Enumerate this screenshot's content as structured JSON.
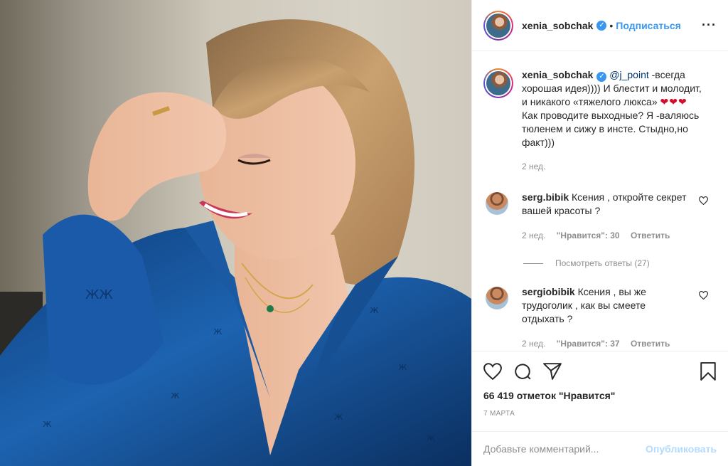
{
  "post": {
    "username": "xenia_sobchak",
    "separator": "•",
    "follow_label": "Подписаться",
    "more_label": "···"
  },
  "caption": {
    "username": "xenia_sobchak",
    "mention": "@j_point",
    "text_before_hearts": " -всегда хорошая идея)))) И блестит и молодит, и никакого «тяжелого люкса» ",
    "hearts": "❤❤❤",
    "text_after_hearts": " Как проводите выходные? Я -валяюсь тюленем и сижу в инсте. Стыдно,но факт)))",
    "time": "2 нед."
  },
  "comments": [
    {
      "username": "serg.bibik",
      "text": "Ксения , откройте секрет вашей красоты ?",
      "time": "2 нед.",
      "likes": "\"Нравится\": 30",
      "reply_label": "Ответить",
      "view_replies": "Посмотреть ответы (27)"
    },
    {
      "username": "sergiobibik",
      "text": "Ксения , вы же трудоголик , как вы смеете отдыхать ?",
      "time": "2 нед.",
      "likes": "\"Нравится\": 37",
      "reply_label": "Ответить"
    }
  ],
  "footer": {
    "likes_count": "66 419 отметок \"Нравится\"",
    "date": "7 МАРТА",
    "comment_placeholder": "Добавьте комментарий...",
    "publish_label": "Опубликовать"
  },
  "icons": {
    "like": "heart-icon",
    "comment": "comment-bubble-icon",
    "share": "paper-plane-icon",
    "save": "bookmark-icon",
    "verified": "verified-badge-icon"
  },
  "colors": {
    "link_blue": "#3897f0",
    "publish_disabled": "#b3dbff",
    "meta_grey": "#8e8e8e",
    "heart_red": "#d40e2a"
  }
}
